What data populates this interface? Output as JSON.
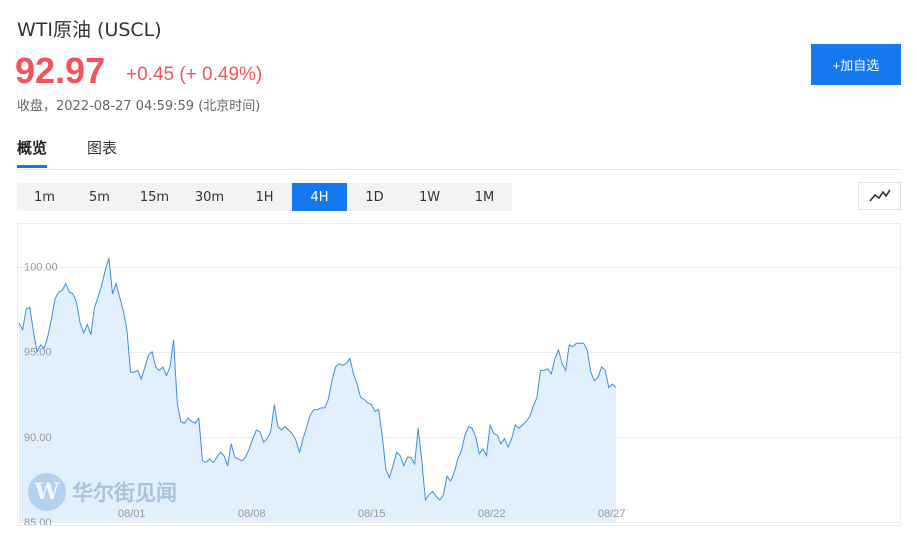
{
  "header": {
    "title": "WTI原油 (USCL)",
    "price": "92.97",
    "change": "+0.45 (+ 0.49%)",
    "status": "收盘，2022-08-27 04:59:59 (北京时间)",
    "add_button": "+加自选"
  },
  "tabs": [
    "概览",
    "图表"
  ],
  "intervals": [
    "1m",
    "5m",
    "15m",
    "30m",
    "1H",
    "4H",
    "1D",
    "1W",
    "1M"
  ],
  "active_interval": "4H",
  "chart_type_icon": "line-chart-icon",
  "colors": {
    "up": "#f5535b",
    "accent": "#1478f0",
    "line": "#3d8ee8",
    "fill": "#e2effc"
  },
  "watermark": {
    "logo_letter": "W",
    "text": "华尔街见闻"
  },
  "chart_data": {
    "type": "area",
    "ylim": [
      85,
      102.5
    ],
    "y_ticks": [
      "100.00",
      "95.00",
      "90.00",
      "85.00"
    ],
    "y_tick_values": [
      100,
      95,
      90,
      85
    ],
    "x_ticks": [
      "08/01",
      "08/08",
      "08/15",
      "08/22",
      "08/27"
    ],
    "values": [
      96.7,
      96.3,
      97.5,
      97.6,
      96.2,
      95.0,
      95.4,
      95.2,
      95.9,
      96.9,
      98.1,
      98.5,
      98.6,
      99.0,
      98.5,
      98.4,
      97.9,
      96.7,
      96.1,
      96.6,
      96.0,
      97.6,
      98.2,
      98.9,
      99.8,
      100.5,
      98.4,
      99.0,
      98.2,
      97.4,
      96.3,
      93.8,
      93.8,
      93.9,
      93.4,
      94.1,
      94.8,
      95.0,
      94.1,
      93.9,
      94.1,
      93.6,
      94.1,
      95.7,
      92.0,
      90.9,
      90.8,
      91.1,
      90.9,
      90.8,
      91.1,
      88.6,
      88.5,
      88.7,
      88.5,
      88.8,
      89.1,
      88.9,
      88.3,
      89.6,
      88.8,
      88.7,
      88.6,
      88.8,
      89.3,
      89.9,
      90.4,
      90.3,
      89.7,
      89.9,
      90.3,
      91.9,
      90.6,
      90.4,
      90.6,
      90.4,
      90.2,
      89.8,
      89.1,
      89.9,
      90.6,
      91.3,
      91.6,
      91.6,
      91.7,
      91.7,
      92.2,
      93.3,
      94.1,
      94.3,
      94.2,
      94.3,
      94.6,
      93.7,
      93.1,
      92.3,
      92.2,
      92.0,
      91.9,
      91.5,
      91.6,
      90.1,
      88.1,
      87.6,
      88.3,
      89.1,
      88.9,
      88.3,
      88.8,
      88.8,
      88.4,
      90.5,
      88.6,
      86.3,
      86.6,
      86.8,
      86.5,
      86.3,
      86.6,
      87.7,
      87.4,
      87.9,
      88.7,
      89.2,
      90.1,
      90.6,
      90.5,
      90.0,
      89.0,
      89.3,
      88.9,
      90.7,
      90.2,
      90.1,
      89.6,
      89.9,
      89.4,
      89.9,
      90.7,
      90.5,
      90.7,
      90.9,
      91.2,
      91.8,
      92.3,
      93.9,
      93.9,
      94.0,
      93.7,
      94.6,
      95.1,
      94.3,
      93.9,
      95.4,
      95.3,
      95.5,
      95.5,
      95.5,
      95.1,
      93.8,
      93.3,
      93.5,
      94.1,
      93.9,
      92.9,
      93.1,
      92.9
    ]
  }
}
